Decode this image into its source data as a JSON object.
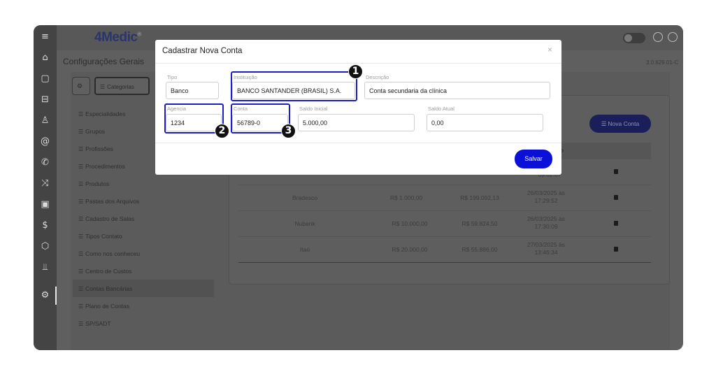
{
  "app": {
    "logo_main": "4Medic",
    "logo_mark": "®",
    "version": "3.0.629.01-C"
  },
  "page": {
    "title": "Configurações Gerais"
  },
  "tabs": [
    {
      "icon": "cogs-icon",
      "label": ""
    },
    {
      "icon": "list-icon",
      "label": "Categorias"
    }
  ],
  "sidebar": {
    "items": [
      {
        "label": "Especialidades"
      },
      {
        "label": "Grupos"
      },
      {
        "label": "Profissões"
      },
      {
        "label": "Procedimentos"
      },
      {
        "label": "Produtos"
      },
      {
        "label": "Pastas dos Arquivos"
      },
      {
        "label": "Cadastro de Salas"
      },
      {
        "label": "Tipos Contato"
      },
      {
        "label": "Como nos conheceu"
      },
      {
        "label": "Centro de Custos"
      },
      {
        "label": "Contas Bancárias",
        "active": true
      },
      {
        "label": "Plano de Contas"
      },
      {
        "label": "SP/SADT"
      }
    ]
  },
  "list": {
    "new_button": "Nova Conta",
    "header_partial": "o",
    "rows": [
      {
        "bank": "",
        "initial": "",
        "current": "",
        "date": "ás",
        "time": "09:02:07"
      },
      {
        "bank": "Bradesco",
        "initial": "R$ 1.000,00",
        "current": "R$ 199.092,13",
        "date": "26/03/2025 às",
        "time": "17:29:52"
      },
      {
        "bank": "Nubank",
        "initial": "R$ 10.000,00",
        "current": "R$ 59.824,50",
        "date": "26/03/2025 às",
        "time": "17:30:09"
      },
      {
        "bank": "Itaú",
        "initial": "R$ 20.000,00",
        "current": "R$ 55.886,00",
        "date": "27/03/2025 às",
        "time": "13:46:34"
      }
    ]
  },
  "modal": {
    "title": "Cadastrar Nova Conta",
    "close": "×",
    "fields": {
      "tipo": {
        "label": "Tipo",
        "value": "Banco"
      },
      "instituicao": {
        "label": "Instituição",
        "value": "BANCO SANTANDER (BRASIL) S.A."
      },
      "descricao": {
        "label": "Descrição",
        "value": "Conta secundaria da clínica"
      },
      "agencia": {
        "label": "Agencia",
        "value": "1234"
      },
      "conta": {
        "label": "Conta",
        "value": "56789-0"
      },
      "saldo_inicial": {
        "label": "Saldo Inicial",
        "value": "5.000,00"
      },
      "saldo_atual": {
        "label": "Saldo Atual",
        "value": "0,00"
      }
    },
    "save_button": "Salvar"
  },
  "callouts": [
    {
      "number": "1"
    },
    {
      "number": "2"
    },
    {
      "number": "3"
    }
  ],
  "colors": {
    "accent": "#0b10d8",
    "callout_border": "#1d1dcb",
    "overlay": "#5f5f5f",
    "dark_button": "#1a1f5a"
  }
}
